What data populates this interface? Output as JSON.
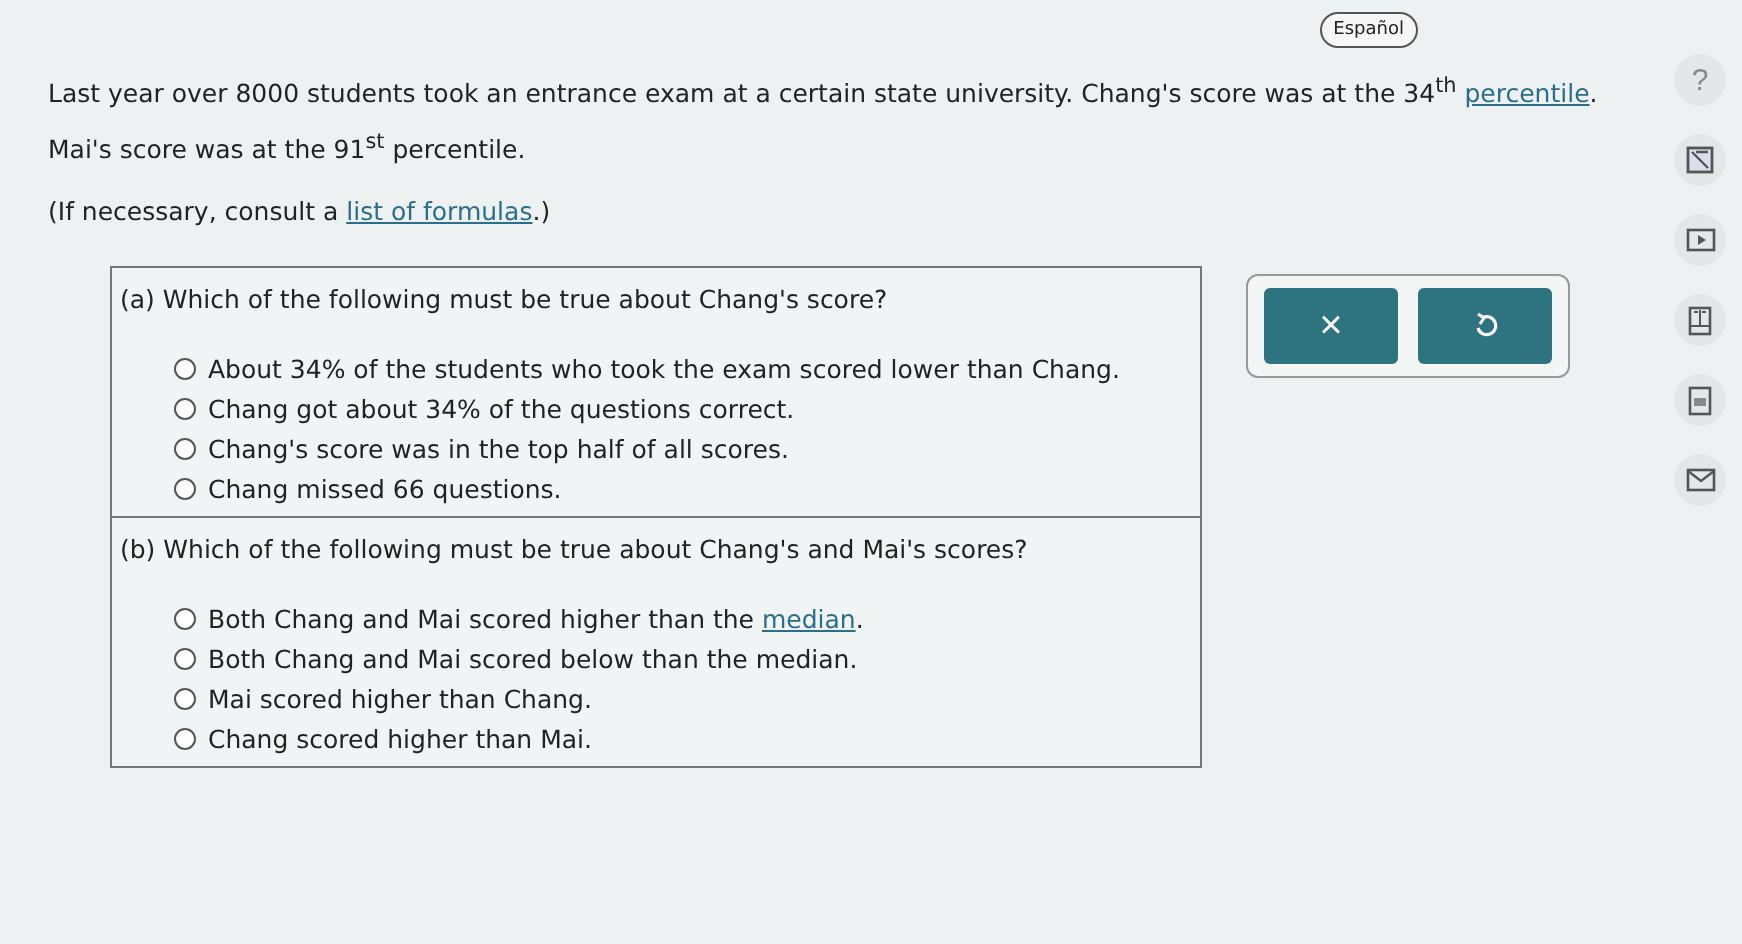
{
  "language_button": {
    "label": "Español"
  },
  "intro": {
    "line_1": "Last year over 8000 students took an entrance exam at a certain state university. Chang's score was at the 34$^{th}$",
    "line_1_link": "percentile",
    "line_1_end": ".",
    "line_2": "Mai's score was at the 91$^{st}$ percentile."
  },
  "note": {
    "before": "(If necessary, consult a",
    "link": "list of formulas",
    "after": ".)"
  },
  "parts": [
    {
      "question": "(a) Which of the following must be true about Chang's score?",
      "options": [
        {
          "text": "About 34% of the students who took the exam scored lower than Chang.",
          "selected": false
        },
        {
          "text": "Chang got about 34% of the questions correct.",
          "selected": false
        },
        {
          "text": "Chang's score was in the top half of all scores.",
          "selected": false
        },
        {
          "text": "Chang missed 66 questions.",
          "selected": false
        }
      ]
    },
    {
      "question": "(b) Which of the following must be true about Chang's and Mai's scores?",
      "options": [
        {
          "text": "Both Chang and Mai scored higher than the",
          "link": "median",
          "after": ".",
          "selected": false
        },
        {
          "text": "Both Chang and Mai scored below than the median.",
          "selected": false
        },
        {
          "text": "Mai scored higher than Chang.",
          "selected": false
        },
        {
          "text": "Chang scored higher than Mai.",
          "selected": false
        }
      ]
    }
  ],
  "action_buttons": [
    {
      "kind": "clear",
      "label": "×"
    },
    {
      "kind": "undo"
    }
  ],
  "side_tools": [
    {
      "kind": "help",
      "label": "?"
    },
    {
      "kind": "calculator"
    },
    {
      "kind": "video"
    },
    {
      "kind": "book"
    },
    {
      "kind": "glossary"
    },
    {
      "kind": "mail"
    }
  ]
}
